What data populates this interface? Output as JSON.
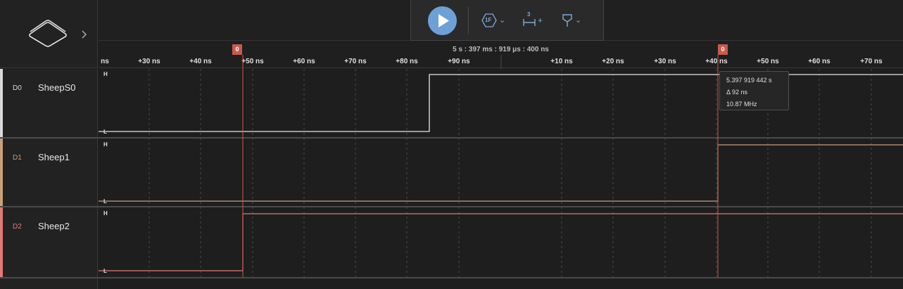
{
  "toolbar": {
    "play_icon": "play-icon",
    "trigger_label": "1F",
    "measure_label": "3",
    "measure_plus": "+",
    "accent": "#6ea0d8"
  },
  "ruler": {
    "timestamp": "5 s : 397 ms : 919 μs : 400 ns",
    "ticks": [
      {
        "label": "ns"
      },
      {
        "label": "+30 ns"
      },
      {
        "label": "+40 ns"
      },
      {
        "label": "+50 ns"
      },
      {
        "label": "+60 ns"
      },
      {
        "label": "+70 ns"
      },
      {
        "label": "+80 ns"
      },
      {
        "label": "+90 ns"
      },
      {
        "label": "+10 ns"
      },
      {
        "label": "+20 ns"
      },
      {
        "label": "+30 ns"
      },
      {
        "label": "+40 ns"
      },
      {
        "label": "+50 ns"
      },
      {
        "label": "+60 ns"
      },
      {
        "label": "+70 ns"
      }
    ],
    "markers": [
      {
        "label": "0"
      },
      {
        "label": "0"
      }
    ]
  },
  "channels": [
    {
      "id": "D0",
      "name": "SheepS0",
      "color": "#d9d9d9",
      "high": "H",
      "low": "L"
    },
    {
      "id": "D1",
      "name": "Sheep1",
      "color": "#c99f7a",
      "high": "H",
      "low": "L"
    },
    {
      "id": "D2",
      "name": "Sheep2",
      "color": "#e07a78",
      "high": "H",
      "low": "L"
    }
  ],
  "tooltip": {
    "time": "5.397 919 442 s",
    "delta": "Δ 92 ns",
    "freq": "10.87 MHz"
  },
  "colors": {
    "marker": "#c9594e",
    "grid": "#4a4a4a",
    "background": "#1e1e1e"
  }
}
